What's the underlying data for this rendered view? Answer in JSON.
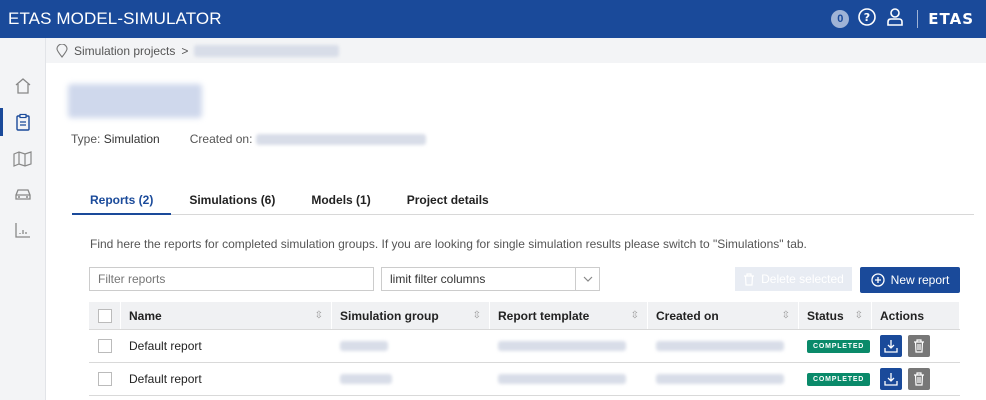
{
  "app": {
    "title": "ETAS MODEL-SIMULATOR",
    "notification_count": "0",
    "brand": "ETAS"
  },
  "breadcrumb": {
    "root": "Simulation projects",
    "separator": ">"
  },
  "project": {
    "type_label": "Type:",
    "type_value": "Simulation",
    "created_label": "Created on:"
  },
  "tabs": [
    {
      "label": "Reports (2)"
    },
    {
      "label": "Simulations (6)"
    },
    {
      "label": "Models (1)"
    },
    {
      "label": "Project details"
    }
  ],
  "info_text": "Find here the reports for completed simulation groups. If you are looking for single simulation results please switch to \"Simulations\" tab.",
  "toolbar": {
    "filter_placeholder": "Filter reports",
    "select_value": "limit filter columns",
    "delete_label": "Delete selected",
    "new_label": "New report"
  },
  "table": {
    "headers": [
      "Name",
      "Simulation group",
      "Report template",
      "Created on",
      "Status",
      "Actions"
    ],
    "rows": [
      {
        "name": "Default report",
        "status": "COMPLETED"
      },
      {
        "name": "Default report",
        "status": "COMPLETED"
      }
    ]
  },
  "colors": {
    "primary": "#1a4a9a",
    "status_completed": "#0a8a6a"
  }
}
